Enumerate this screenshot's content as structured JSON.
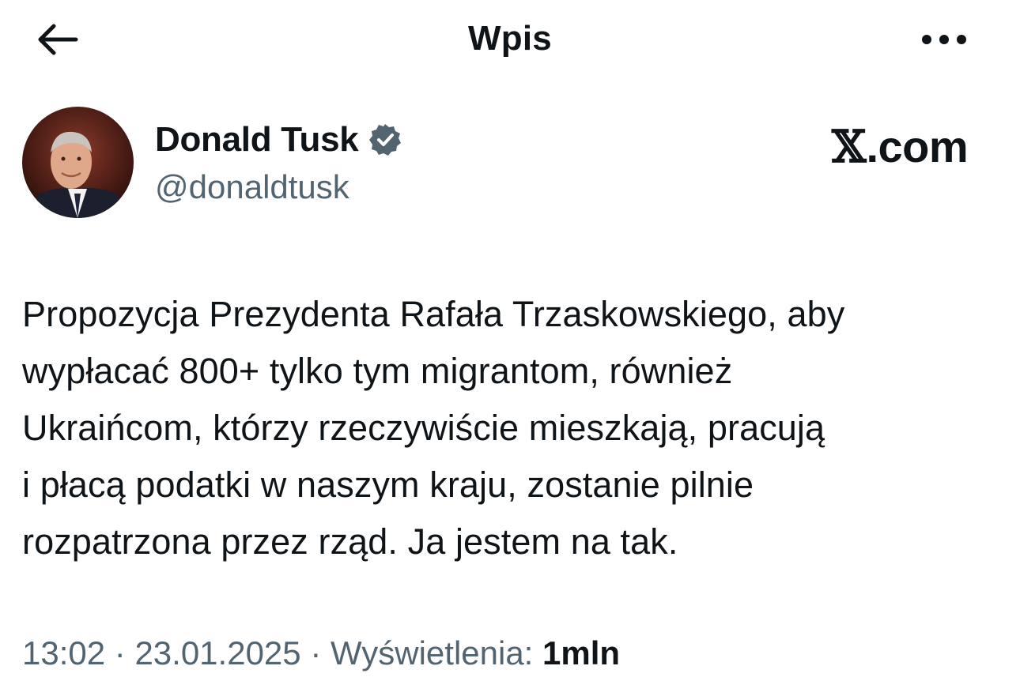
{
  "header": {
    "title": "Wpis",
    "back_icon": "arrow-left-icon",
    "more_icon": "more-horizontal-icon"
  },
  "author": {
    "display_name": "Donald Tusk",
    "handle": "@donaldtusk",
    "verified": true,
    "verified_color": "#536471"
  },
  "brand": {
    "x_glyph": "𝕏",
    "suffix": ".com"
  },
  "tweet": {
    "lines": [
      "Propozycja Prezydenta Rafała Trzaskowskiego, aby",
      "wypłacać 800+ tylko tym migrantom, również",
      "Ukraińcom, którzy rzeczywiście mieszkają, pracują",
      "i płacą podatki w naszym kraju, zostanie pilnie",
      "rozpatrzona przez rząd. Ja jestem na tak."
    ]
  },
  "meta": {
    "time": "13:02",
    "separator": " · ",
    "date": "23.01.2025",
    "views_label": "Wyświetlenia: ",
    "views_count": "1mln"
  },
  "colors": {
    "text": "#0f1419",
    "secondary": "#536471",
    "background": "#ffffff"
  }
}
